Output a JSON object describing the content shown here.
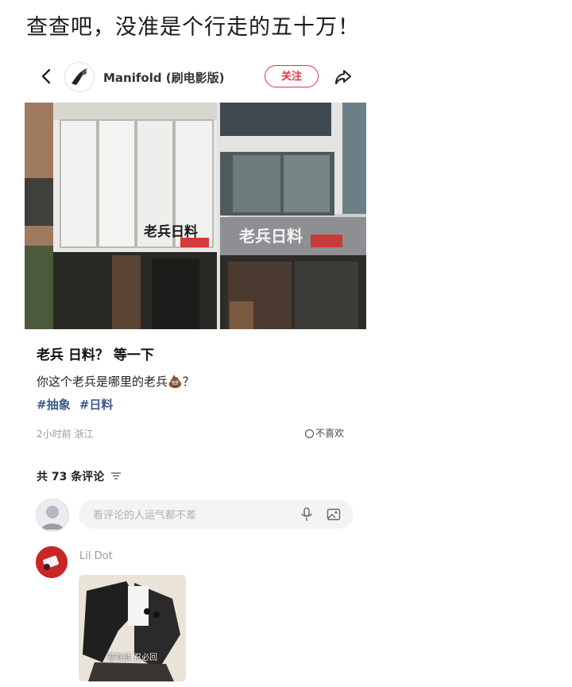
{
  "caption": "查查吧，没准是个行走的五十万！",
  "header": {
    "author_name": "Manifold (刷电影版)",
    "follow_label": "关注"
  },
  "post": {
    "sign_left": "老兵日料",
    "sign_right": "老兵日料",
    "title": "老兵 日料？ 等一下",
    "body": "你这个老兵是哪里的老兵💩？",
    "tags": [
      "#抽象",
      "#日料"
    ],
    "meta": "2小时前 浙江",
    "dislike_label": "不喜欢"
  },
  "comments": {
    "count_label": "共 73 条评论",
    "input_placeholder": "看评论的人运气都不差",
    "items": [
      {
        "user": "Lil Dot",
        "image_caption": "若有战 召必回"
      }
    ]
  },
  "colors": {
    "accent": "#e3344a",
    "tag": "#3d5a8c"
  }
}
